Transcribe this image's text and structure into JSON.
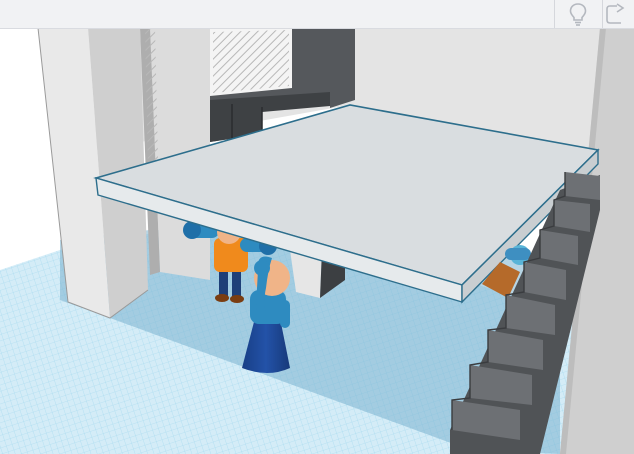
{
  "toolbar": {
    "buttons": [
      {
        "id": "tips",
        "icon": "lightbulb-icon"
      },
      {
        "id": "share",
        "icon": "share-icon"
      }
    ]
  },
  "scene": {
    "objects": [
      {
        "id": "mezzanine-floor",
        "type": "box"
      },
      {
        "id": "staircase",
        "type": "stairs"
      },
      {
        "id": "figure-orange-shirt",
        "type": "figure"
      },
      {
        "id": "figure-blue-dress",
        "type": "figure"
      },
      {
        "id": "figure-crouching",
        "type": "figure"
      }
    ]
  },
  "colors": {
    "toolbar_bg": "#f1f2f4",
    "grid_base": "#d6edf7",
    "grid_line": "#8fd0ea",
    "wall": "#e3e3e3",
    "floor_slab": "#d9dde0",
    "selection_outline": "#2d6e8c",
    "figure_blue": "#1f5fa0",
    "figure_orange": "#f08a1c",
    "skin": "#f0b488"
  }
}
